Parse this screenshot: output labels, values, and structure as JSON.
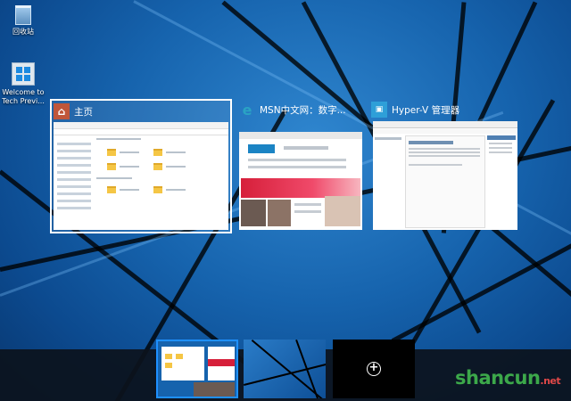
{
  "desktop": {
    "icons": [
      {
        "label": "回收站",
        "icon": "recycle-bin-icon"
      },
      {
        "label": "Welcome to Tech Previ...",
        "icon": "windows-welcome-icon"
      }
    ]
  },
  "task_view": {
    "windows": [
      {
        "title": "主页",
        "icon": "home-icon",
        "selected": true
      },
      {
        "title": "MSN中文网：数字...",
        "icon": "edge-e-icon",
        "selected": false
      },
      {
        "title": "Hyper-V 管理器",
        "icon": "hyperv-icon",
        "selected": false
      }
    ]
  },
  "virtual_desktops": {
    "add_icon": "plus-icon"
  },
  "watermark": {
    "main": "shancun",
    "suffix": ".net"
  },
  "colors": {
    "accent": "#1c72c8",
    "selection_border": "#ffffff",
    "home_icon_bg": "#c0563a",
    "edge_icon": "#2aa3c4",
    "hyperv_icon": "#2e9fd8"
  }
}
